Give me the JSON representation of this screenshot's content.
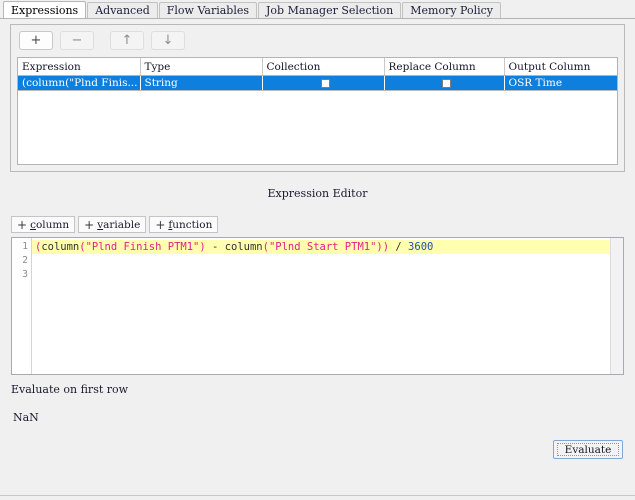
{
  "window": {
    "title": "Expressions"
  },
  "tabs": [
    {
      "label": "Expressions",
      "active": true
    },
    {
      "label": "Advanced",
      "active": false
    },
    {
      "label": "Flow Variables",
      "active": false
    },
    {
      "label": "Job Manager Selection",
      "active": false
    },
    {
      "label": "Memory Policy",
      "active": false
    }
  ],
  "toolbar": {
    "add_label": "+",
    "remove_label": "−",
    "move_up_label": "↑",
    "move_down_label": "↓"
  },
  "table": {
    "columns": [
      "Expression",
      "Type",
      "Collection",
      "Replace Column",
      "Output Column"
    ],
    "rows": [
      {
        "expression": "(column(\"Plnd Finis...",
        "type": "String",
        "collection": false,
        "replace_column": false,
        "output_column": "OSR Time",
        "selected": true
      }
    ]
  },
  "editor": {
    "title": "Expression Editor",
    "insert_buttons": [
      {
        "plus": "+",
        "pre": "",
        "mnemonic": "c",
        "post": "olumn"
      },
      {
        "plus": "+",
        "pre": "",
        "mnemonic": "v",
        "post": "ariable"
      },
      {
        "plus": "+",
        "pre": "",
        "mnemonic": "f",
        "post": "unction"
      }
    ],
    "line_numbers": [
      "1",
      "2",
      "3"
    ],
    "code_tokens": [
      {
        "text": "(",
        "kind": "paren"
      },
      {
        "text": "column",
        "kind": "func"
      },
      {
        "text": "(",
        "kind": "paren"
      },
      {
        "text": "\"Plnd Finish PTM1\"",
        "kind": "str"
      },
      {
        "text": ")",
        "kind": "paren"
      },
      {
        "text": " - ",
        "kind": "op"
      },
      {
        "text": "column",
        "kind": "func"
      },
      {
        "text": "(",
        "kind": "paren"
      },
      {
        "text": "\"Plnd Start PTM1\"",
        "kind": "str"
      },
      {
        "text": "))",
        "kind": "paren"
      },
      {
        "text": " / ",
        "kind": "op"
      },
      {
        "text": "3600",
        "kind": "num"
      }
    ],
    "code_plain": "(column(\"Plnd Finish PTM1\") - column(\"Plnd Start PTM1\")) / 3600"
  },
  "result": {
    "label": "Evaluate on first row",
    "value": "NaN"
  },
  "actions": {
    "evaluate_label": "Evaluate"
  },
  "colors": {
    "selection_blue": "#0f7fde",
    "current_line_yellow": "#ffffaf",
    "string_magenta": "#e0218a",
    "number_blue": "#1b4fb5",
    "panel_gray": "#f0f0f0",
    "focus_border": "#7fa8d8"
  }
}
